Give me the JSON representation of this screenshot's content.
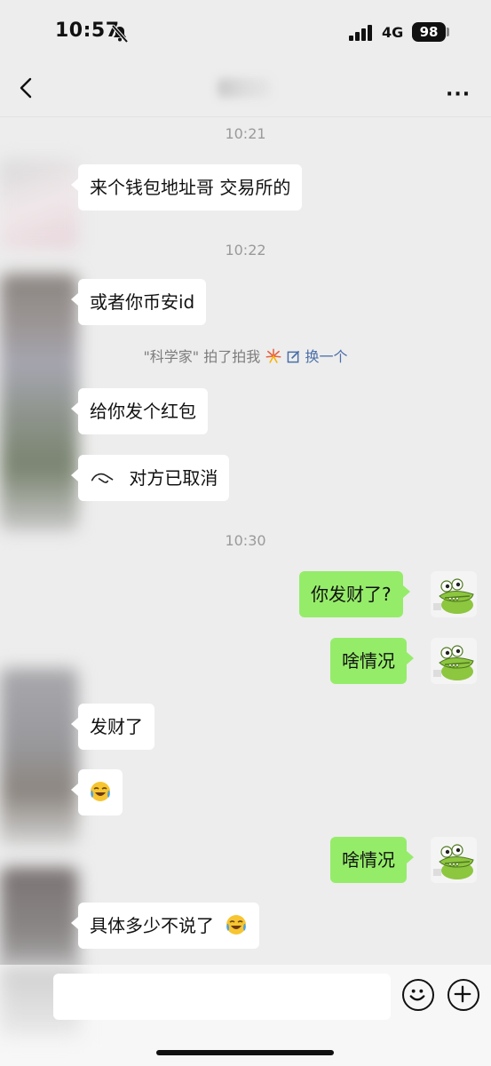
{
  "status_bar": {
    "time": "10:57",
    "network": "4G",
    "battery": "98"
  },
  "nav": {
    "more_label": "···"
  },
  "timestamps": [
    "10:21",
    "10:22",
    "10:30"
  ],
  "messages": [
    {
      "side": "in",
      "text": "来个钱包地址哥 交易所的"
    },
    {
      "side": "in",
      "text": "或者你币安id"
    },
    {
      "side": "in",
      "text": "给你发个红包"
    },
    {
      "side": "in",
      "text": "对方已取消"
    },
    {
      "side": "out",
      "text": "你发财了?"
    },
    {
      "side": "out",
      "text": "啥情况"
    },
    {
      "side": "in",
      "text": "发财了"
    },
    {
      "side": "out",
      "text": "啥情况"
    },
    {
      "side": "in",
      "text": "具体多少不说了"
    }
  ],
  "pat_notice": {
    "text": "\"科学家\" 拍了拍我",
    "action": "换一个"
  },
  "colors": {
    "background": "#ededed",
    "outgoing_bubble": "#95ec69",
    "incoming_bubble": "#ffffff",
    "link": "#4a6ea9"
  },
  "icons": [
    "back-arrow-icon",
    "more-icon",
    "bell-slash-icon",
    "emoji-button-icon",
    "plus-button-icon",
    "crying-laughing-emoji-icon",
    "crocodile-avatar-icon"
  ]
}
